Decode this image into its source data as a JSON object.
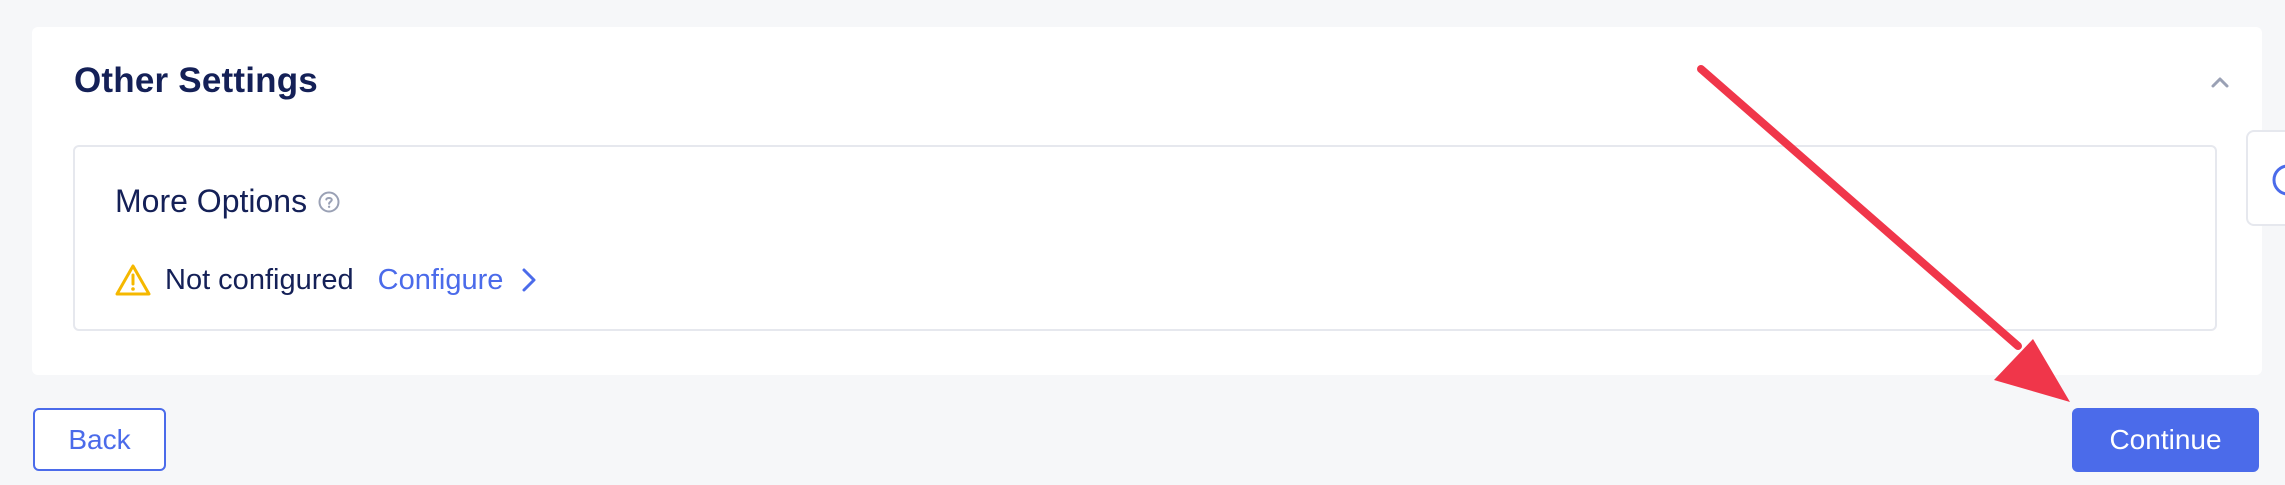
{
  "section": {
    "title": "Other Settings",
    "collapse_icon": "chevron-up-icon"
  },
  "more_options": {
    "title": "More Options",
    "help_icon": "question-circle-icon",
    "status_icon": "warning-triangle-icon",
    "status_text": "Not configured",
    "configure_label": "Configure",
    "configure_icon": "chevron-right-icon"
  },
  "side_panel": {
    "icon": "help-circle-icon"
  },
  "footer": {
    "back_label": "Back",
    "continue_label": "Continue"
  },
  "colors": {
    "accent": "#4b6bea",
    "title": "#142057",
    "warning": "#f5b800",
    "annotation": "#f0364a",
    "background": "#f6f7f9"
  }
}
